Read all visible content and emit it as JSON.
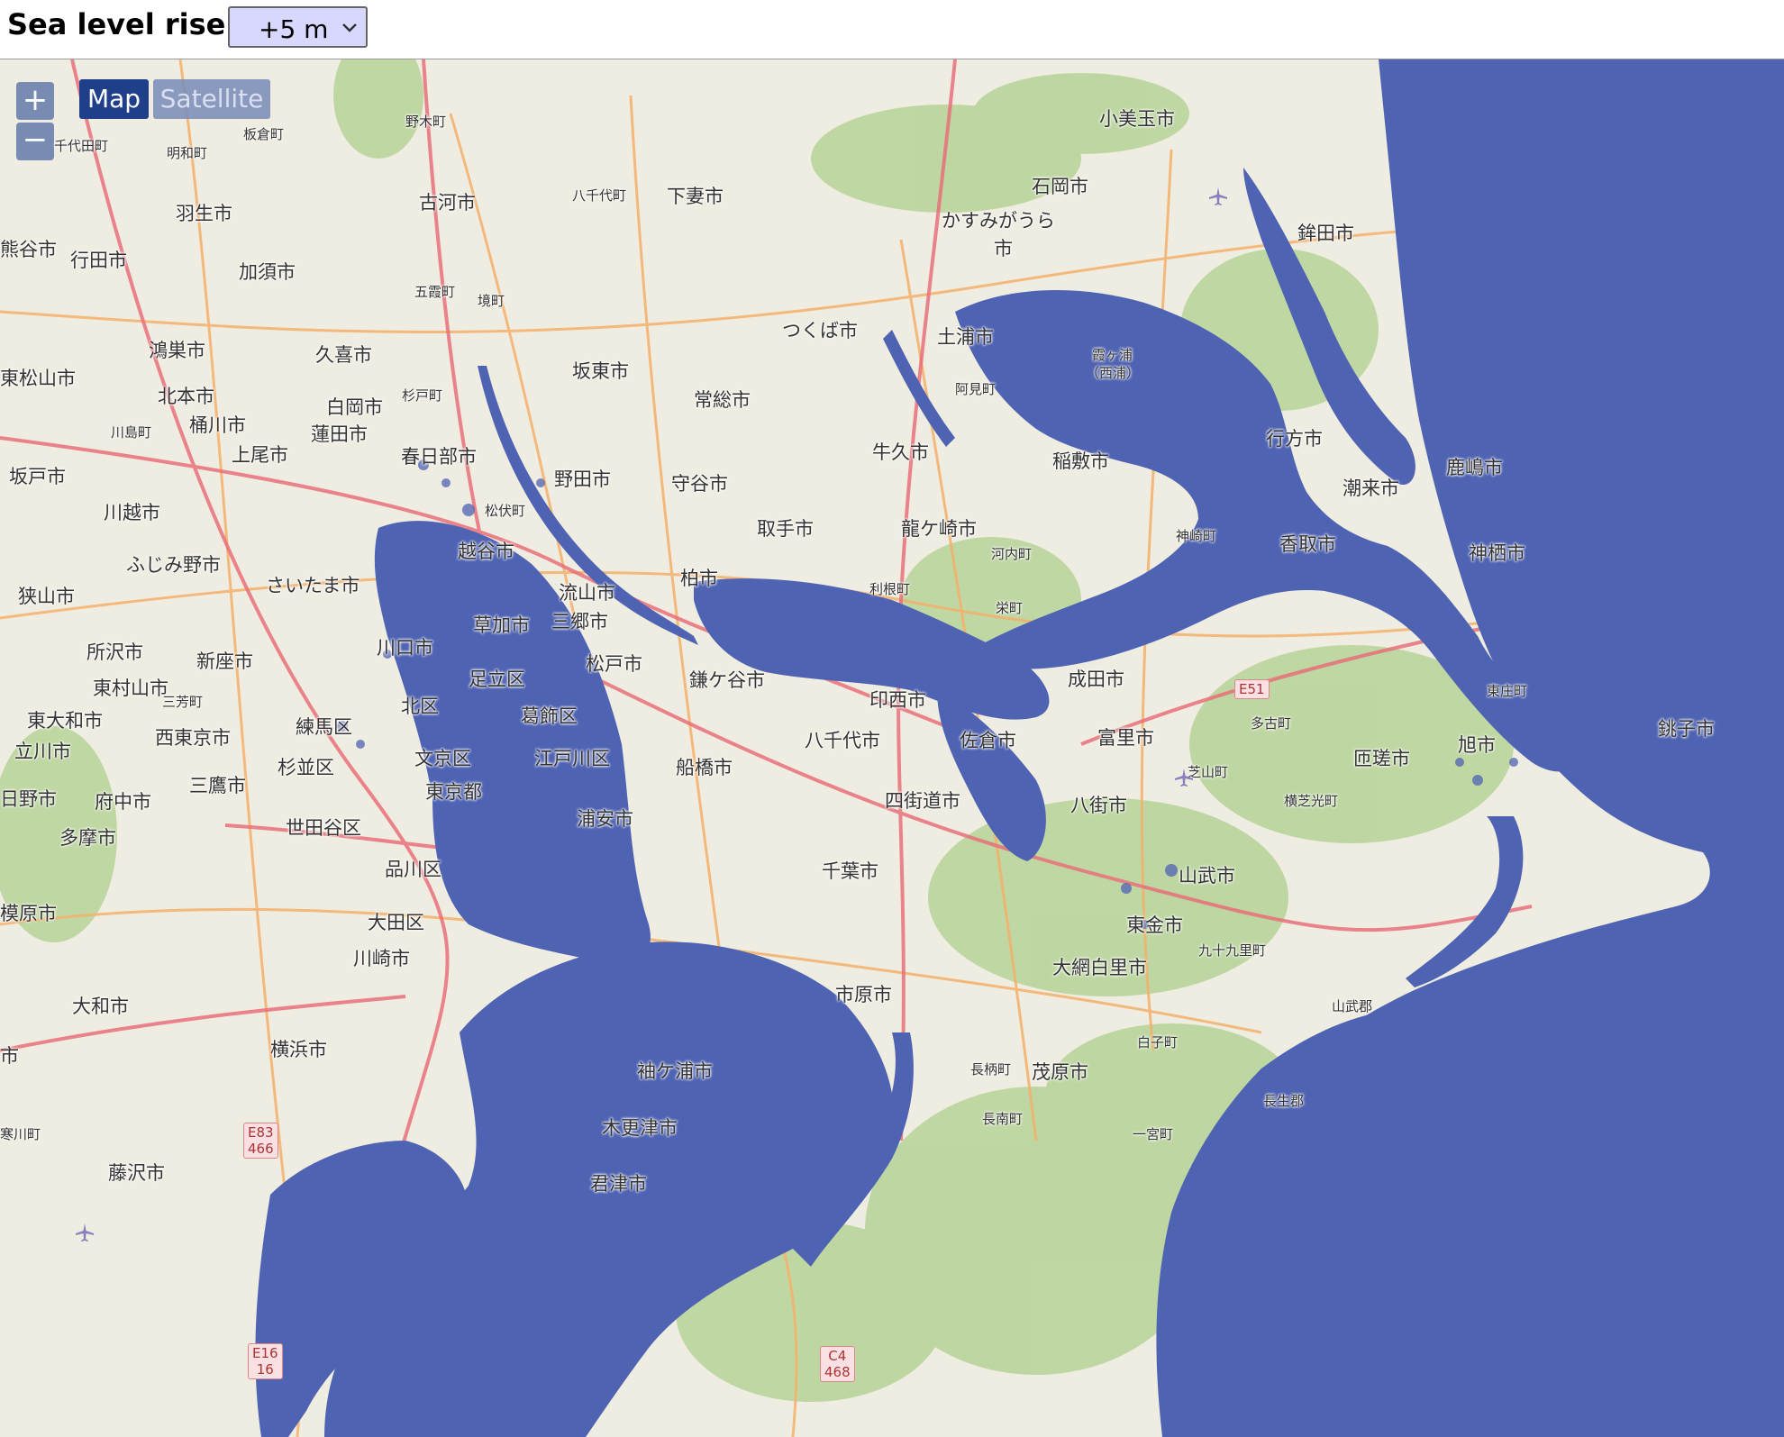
{
  "header": {
    "title": "Sea level rise:",
    "selected_rise": "+5 m"
  },
  "map_controls": {
    "zoom_in": "+",
    "zoom_out": "−",
    "layer_map": "Map",
    "layer_satellite": "Satellite"
  },
  "colors": {
    "flood": "#4f63b3",
    "land": "#efece1",
    "forest": "#b9d59c",
    "major_road": "#e8707a",
    "secondary_road": "#f4b06b"
  },
  "places": [
    {
      "id": "nogi",
      "name": "野木町"
    },
    {
      "id": "chiyoda",
      "name": "千代田町"
    },
    {
      "id": "itakura",
      "name": "板倉町"
    },
    {
      "id": "meiwa",
      "name": "明和町"
    },
    {
      "id": "komitama",
      "name": "小美玉市"
    },
    {
      "id": "ishioka",
      "name": "石岡市"
    },
    {
      "id": "koga",
      "name": "古河市"
    },
    {
      "id": "yachiyo-town",
      "name": "八千代町"
    },
    {
      "id": "shimotsuma",
      "name": "下妻市"
    },
    {
      "id": "hanyu",
      "name": "羽生市"
    },
    {
      "id": "kumagaya",
      "name": "熊谷市"
    },
    {
      "id": "gyoda",
      "name": "行田市"
    },
    {
      "id": "kazo",
      "name": "加須市"
    },
    {
      "id": "kasumigaura",
      "name": "かすみがうら"
    },
    {
      "id": "kasumigaura2",
      "name": "市"
    },
    {
      "id": "hokota",
      "name": "鉾田市"
    },
    {
      "id": "goka",
      "name": "五霞町"
    },
    {
      "id": "sakai",
      "name": "境町"
    },
    {
      "id": "tsukuba",
      "name": "つくば市"
    },
    {
      "id": "tsuchiura",
      "name": "土浦市"
    },
    {
      "id": "konosu",
      "name": "鴻巣市"
    },
    {
      "id": "kuki",
      "name": "久喜市"
    },
    {
      "id": "kasumigaura-lake",
      "name": "霞ヶ浦"
    },
    {
      "id": "nishiura",
      "name": "（西浦）"
    },
    {
      "id": "bando",
      "name": "坂東市"
    },
    {
      "id": "higashimatsuyama",
      "name": "東松山市"
    },
    {
      "id": "ami",
      "name": "阿見町"
    },
    {
      "id": "kitamoto",
      "name": "北本市"
    },
    {
      "id": "sugito",
      "name": "杉戸町"
    },
    {
      "id": "joso",
      "name": "常総市"
    },
    {
      "id": "shiraoka",
      "name": "白岡市"
    },
    {
      "id": "okegawa",
      "name": "桶川市"
    },
    {
      "id": "kawajima",
      "name": "川島町"
    },
    {
      "id": "hasuda",
      "name": "蓮田市"
    },
    {
      "id": "namegata",
      "name": "行方市"
    },
    {
      "id": "ushiku",
      "name": "牛久市"
    },
    {
      "id": "ageo",
      "name": "上尾市"
    },
    {
      "id": "kasukabe",
      "name": "春日部市"
    },
    {
      "id": "inashiki",
      "name": "稲敷市"
    },
    {
      "id": "kashima",
      "name": "鹿嶋市"
    },
    {
      "id": "sakado",
      "name": "坂戸市"
    },
    {
      "id": "noda",
      "name": "野田市"
    },
    {
      "id": "moriya",
      "name": "守谷市"
    },
    {
      "id": "itako",
      "name": "潮来市"
    },
    {
      "id": "kawagoe",
      "name": "川越市"
    },
    {
      "id": "matsubushi",
      "name": "松伏町"
    },
    {
      "id": "toride",
      "name": "取手市"
    },
    {
      "id": "ryugasaki",
      "name": "龍ケ崎市"
    },
    {
      "id": "kozaki",
      "name": "神崎町"
    },
    {
      "id": "katori",
      "name": "香取市"
    },
    {
      "id": "koshigaya",
      "name": "越谷市"
    },
    {
      "id": "kamisu",
      "name": "神栖市"
    },
    {
      "id": "kawachi",
      "name": "河内町"
    },
    {
      "id": "fujimino",
      "name": "ふじみ野市"
    },
    {
      "id": "saitama",
      "name": "さいたま市"
    },
    {
      "id": "nagareyama",
      "name": "流山市"
    },
    {
      "id": "kashiwa",
      "name": "柏市"
    },
    {
      "id": "sayama",
      "name": "狭山市"
    },
    {
      "id": "tone",
      "name": "利根町"
    },
    {
      "id": "sakae",
      "name": "栄町"
    },
    {
      "id": "e51",
      "name": "E51"
    },
    {
      "id": "tonosho",
      "name": "東庄町"
    },
    {
      "id": "misato",
      "name": "三郷市"
    },
    {
      "id": "miyoshi",
      "name": "三芳町"
    },
    {
      "id": "soka",
      "name": "草加市"
    },
    {
      "id": "inzai",
      "name": "印西市"
    },
    {
      "id": "kawaguchi",
      "name": "川口市"
    },
    {
      "id": "tokorozawa",
      "name": "所沢市"
    },
    {
      "id": "niiza",
      "name": "新座市"
    },
    {
      "id": "matsudo",
      "name": "松戸市"
    },
    {
      "id": "adachi",
      "name": "足立区"
    },
    {
      "id": "kamagaya",
      "name": "鎌ケ谷市"
    },
    {
      "id": "narita",
      "name": "成田市"
    },
    {
      "id": "higashimurayama",
      "name": "東村山市"
    },
    {
      "id": "kita",
      "name": "北区"
    },
    {
      "id": "higashiyamato",
      "name": "東大和市"
    },
    {
      "id": "katsushika",
      "name": "葛飾区"
    },
    {
      "id": "nerima",
      "name": "練馬区"
    },
    {
      "id": "tako",
      "name": "多古町"
    },
    {
      "id": "nishitokyo",
      "name": "西東京市"
    },
    {
      "id": "yachiyo",
      "name": "八千代市"
    },
    {
      "id": "sakura",
      "name": "佐倉市"
    },
    {
      "id": "tomisato",
      "name": "富里市"
    },
    {
      "id": "choshi",
      "name": "銚子市"
    },
    {
      "id": "tachikawa",
      "name": "立川市"
    },
    {
      "id": "bunkyo",
      "name": "文京区"
    },
    {
      "id": "edogawa",
      "name": "江戸川区"
    },
    {
      "id": "asahi",
      "name": "旭市"
    },
    {
      "id": "suginami",
      "name": "杉並区"
    },
    {
      "id": "sosa",
      "name": "匝瑳市"
    },
    {
      "id": "funabashi",
      "name": "船橋市"
    },
    {
      "id": "shibayama",
      "name": "芝山町"
    },
    {
      "id": "mitaka",
      "name": "三鷹市"
    },
    {
      "id": "hino",
      "name": "日野市"
    },
    {
      "id": "fuchu",
      "name": "府中市"
    },
    {
      "id": "tokyo",
      "name": "東京都"
    },
    {
      "id": "yotsukaido",
      "name": "四街道市"
    },
    {
      "id": "yokoshiba",
      "name": "横芝光町"
    },
    {
      "id": "yachimata",
      "name": "八街市"
    },
    {
      "id": "urayasu",
      "name": "浦安市"
    },
    {
      "id": "setagaya",
      "name": "世田谷区"
    },
    {
      "id": "tama",
      "name": "多摩市"
    },
    {
      "id": "chiba",
      "name": "千葉市"
    },
    {
      "id": "shinagawa",
      "name": "品川区"
    },
    {
      "id": "sammu",
      "name": "山武市"
    },
    {
      "id": "sagamihara",
      "name": "模原市"
    },
    {
      "id": "ota",
      "name": "大田区"
    },
    {
      "id": "togane",
      "name": "東金市"
    },
    {
      "id": "kujukuri",
      "name": "九十九里町"
    },
    {
      "id": "kawasaki",
      "name": "川崎市"
    },
    {
      "id": "oamishirasato",
      "name": "大網白里市"
    },
    {
      "id": "ichihara",
      "name": "市原市"
    },
    {
      "id": "sambu-gun",
      "name": "山武郡"
    },
    {
      "id": "yamato",
      "name": "大和市"
    },
    {
      "id": "shirako",
      "name": "白子町"
    },
    {
      "id": "yokohama",
      "name": "横浜市"
    },
    {
      "id": "nagara",
      "name": "長柄町"
    },
    {
      "id": "mobara",
      "name": "茂原市"
    },
    {
      "id": "sodegaura",
      "name": "袖ケ浦市"
    },
    {
      "id": "chosei-gun",
      "name": "長生郡"
    },
    {
      "id": "chonan",
      "name": "長南町"
    },
    {
      "id": "kisarazu",
      "name": "木更津市"
    },
    {
      "id": "ichinomiya",
      "name": "一宮町"
    },
    {
      "id": "samukawa",
      "name": "寒川町"
    },
    {
      "id": "fujisawa",
      "name": "藤沢市"
    },
    {
      "id": "kimitsu",
      "name": "君津市"
    },
    {
      "id": "ebina",
      "name": "市"
    },
    {
      "id": "zama",
      "name": "市"
    }
  ],
  "road_shields": [
    {
      "id": "e83",
      "line1": "E83",
      "line2": "466"
    },
    {
      "id": "e16",
      "line1": "E16",
      "line2": "16"
    },
    {
      "id": "c4",
      "line1": "C4",
      "line2": "468"
    }
  ]
}
